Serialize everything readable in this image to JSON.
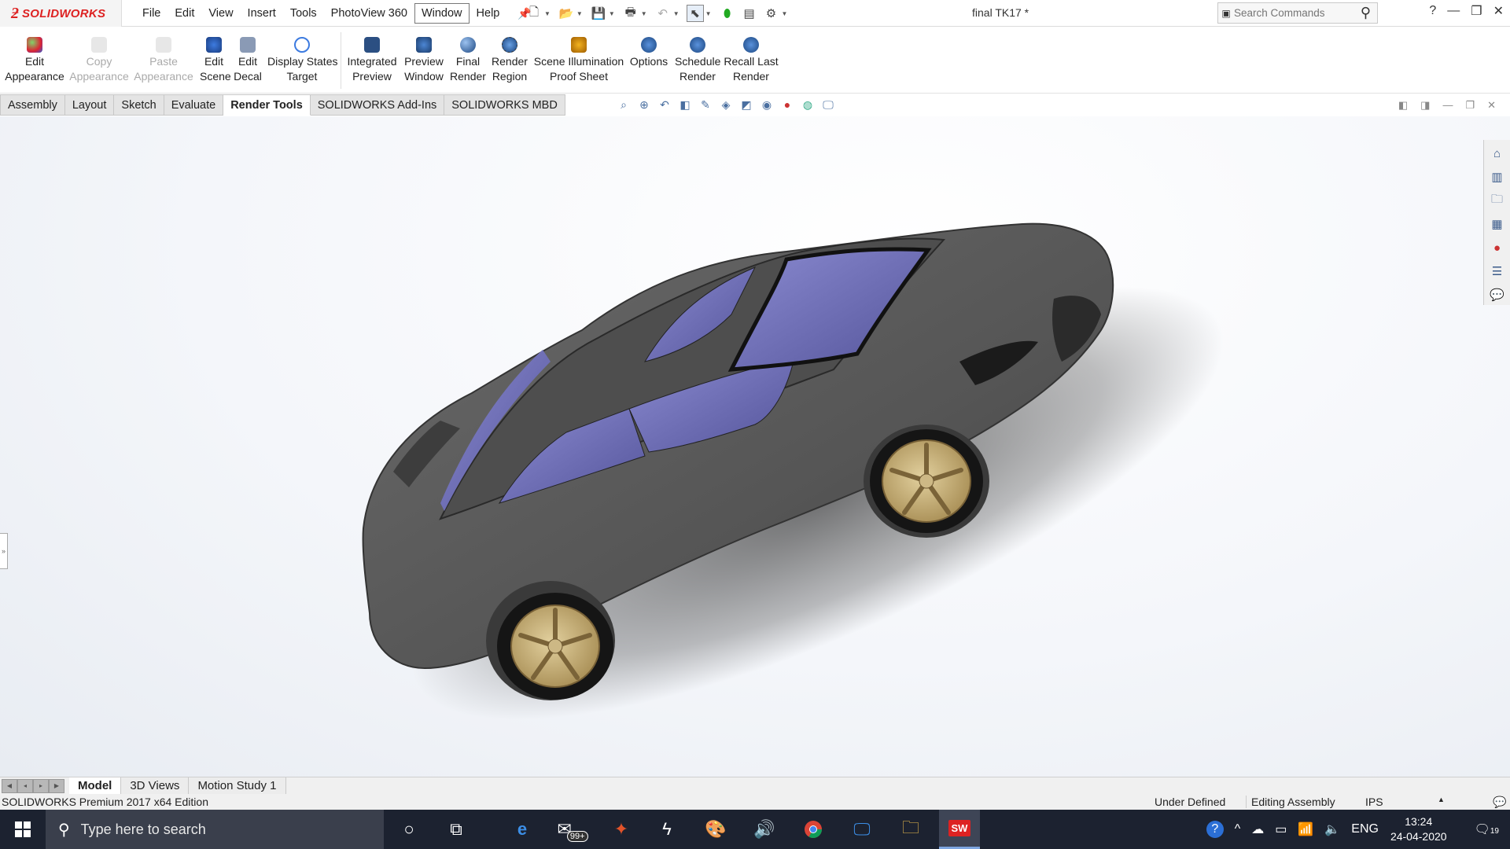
{
  "app": {
    "brand": "SOLIDWORKS",
    "document_title": "final TK17 *"
  },
  "menu": [
    "File",
    "Edit",
    "View",
    "Insert",
    "Tools",
    "PhotoView 360",
    "Window",
    "Help"
  ],
  "search": {
    "placeholder": "Search Commands"
  },
  "commands": {
    "edit_appearance": "Edit\nAppearance",
    "copy_appearance": "Copy\nAppearance",
    "paste_appearance": "Paste\nAppearance",
    "edit_scene": "Edit\nScene",
    "edit_decal": "Edit\nDecal",
    "display_states_target": "Display States\nTarget",
    "integrated_preview": "Integrated\nPreview",
    "preview_window": "Preview\nWindow",
    "final_render": "Final\nRender",
    "render_region": "Render\nRegion",
    "scene_illumination": "Scene Illumination\nProof Sheet",
    "options": "Options",
    "schedule_render": "Schedule\nRender",
    "recall_last_render": "Recall Last\nRender"
  },
  "tabs": [
    "Assembly",
    "Layout",
    "Sketch",
    "Evaluate",
    "Render Tools",
    "SOLIDWORKS Add-Ins",
    "SOLIDWORKS MBD"
  ],
  "active_tab": "Render Tools",
  "bottom_tabs": [
    "Model",
    "3D Views",
    "Motion Study 1"
  ],
  "status": {
    "edition": "SOLIDWORKS Premium 2017 x64 Edition",
    "defined": "Under Defined",
    "mode": "Editing Assembly",
    "units": "IPS"
  },
  "taskbar": {
    "search_placeholder": "Type here to search",
    "mail_badge": "99+",
    "language": "ENG",
    "time": "13:24",
    "date": "24-04-2020",
    "notifications": "19"
  },
  "colors": {
    "brand_red": "#d22222",
    "car_body": "#5b5b5b",
    "glass": "#6e6fb8",
    "wheel": "#c8b27a",
    "taskbar": "#1c2230"
  }
}
